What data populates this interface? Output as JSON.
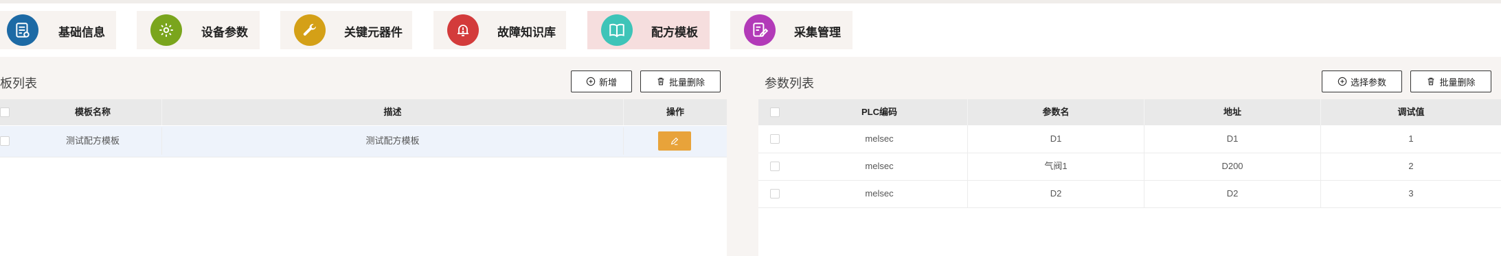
{
  "nav": {
    "items": [
      {
        "label": "基础信息",
        "icon": "document-icon",
        "color": "#1d6aa5"
      },
      {
        "label": "设备参数",
        "icon": "gear-icon",
        "color": "#7aa51d"
      },
      {
        "label": "关键元器件",
        "icon": "wrench-icon",
        "color": "#d4a017"
      },
      {
        "label": "故障知识库",
        "icon": "alert-bell-icon",
        "color": "#d33b3b"
      },
      {
        "label": "配方模板",
        "icon": "book-icon",
        "color": "#3ec4b8",
        "active": true
      },
      {
        "label": "采集管理",
        "icon": "edit-icon",
        "color": "#b23ab8"
      }
    ]
  },
  "left": {
    "title": "模板列表",
    "add_label": "新增",
    "batch_delete_label": "批量删除",
    "columns": [
      "模板名称",
      "描述",
      "操作"
    ],
    "rows": [
      {
        "name": "测试配方模板",
        "description": "测试配方模板"
      }
    ]
  },
  "right": {
    "title": "参数列表",
    "select_label": "选择参数",
    "batch_delete_label": "批量删除",
    "columns": [
      "PLC编码",
      "参数名",
      "地址",
      "调试值"
    ],
    "rows": [
      {
        "plc": "melsec",
        "param": "D1",
        "address": "D1",
        "debug": "1"
      },
      {
        "plc": "melsec",
        "param": "气阀1",
        "address": "D200",
        "debug": "2"
      },
      {
        "plc": "melsec",
        "param": "D2",
        "address": "D2",
        "debug": "3"
      }
    ]
  },
  "colors": {
    "edit_button": "#e8a33a",
    "active_tab": "#f6dede"
  }
}
